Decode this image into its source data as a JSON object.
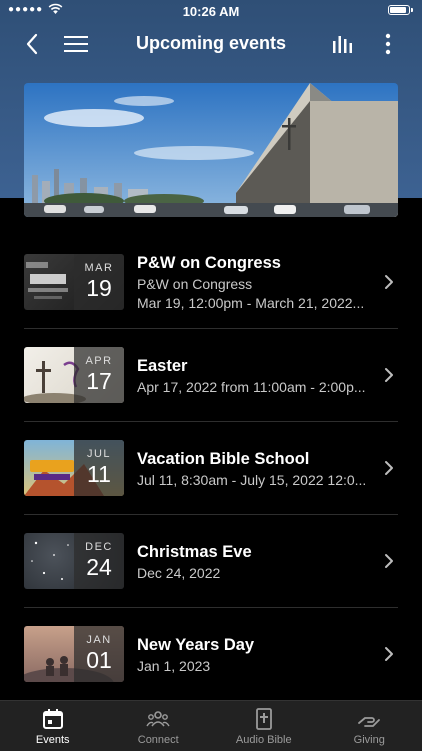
{
  "status_bar": {
    "signal": "●●●●●",
    "time": "10:26 AM",
    "battery": 0.95
  },
  "nav": {
    "title": "Upcoming events"
  },
  "events": [
    {
      "title": "P&W on Congress",
      "subtitle": "P&W on Congress",
      "detail": "Mar 19, 12:00pm - March 21, 2022...",
      "month": "MAR",
      "day": "19"
    },
    {
      "title": "Easter",
      "subtitle": "",
      "detail": "Apr 17, 2022 from 11:00am - 2:00p...",
      "month": "APR",
      "day": "17"
    },
    {
      "title": "Vacation Bible School",
      "subtitle": "",
      "detail": "Jul 11, 8:30am - July 15, 2022 12:0...",
      "month": "JUL",
      "day": "11"
    },
    {
      "title": "Christmas Eve",
      "subtitle": "",
      "detail": "Dec 24, 2022",
      "month": "DEC",
      "day": "24"
    },
    {
      "title": "New Years Day",
      "subtitle": "",
      "detail": "Jan 1, 2023",
      "month": "JAN",
      "day": "01"
    }
  ],
  "tabs": [
    {
      "label": "Events",
      "icon": "calendar-icon",
      "active": true
    },
    {
      "label": "Connect",
      "icon": "people-icon",
      "active": false
    },
    {
      "label": "Audio Bible",
      "icon": "bible-icon",
      "active": false
    },
    {
      "label": "Giving",
      "icon": "giving-hand-icon",
      "active": false
    }
  ],
  "colors": {
    "header_blue": "#2f4f76",
    "background": "#000000",
    "tab_bar": "#222222"
  }
}
